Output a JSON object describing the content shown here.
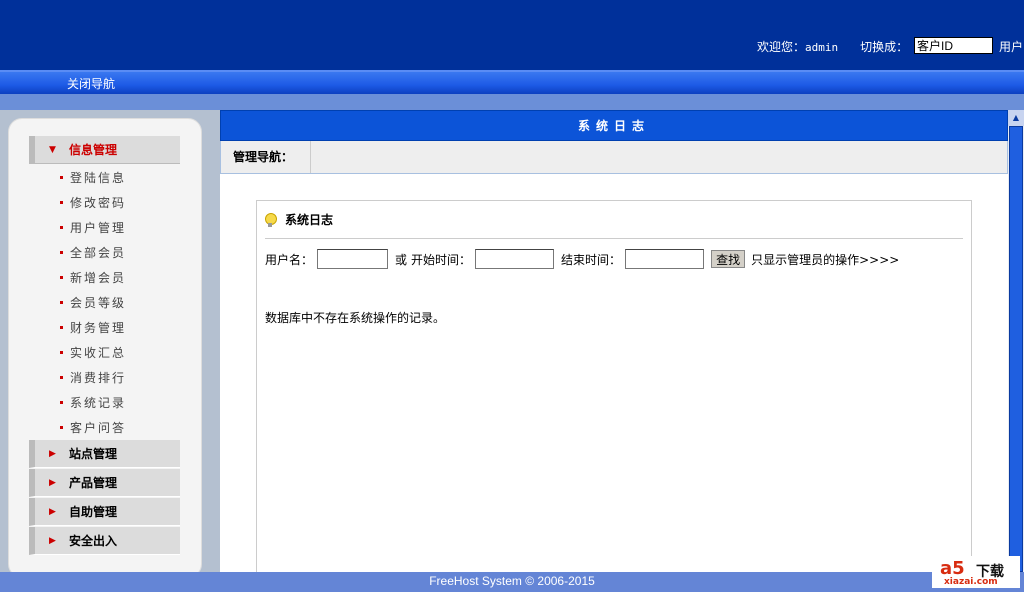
{
  "header": {
    "welcome": "欢迎您：",
    "username": "admin",
    "switch_label": "切换成：",
    "switch_value": "客户ID",
    "user_label": "用户"
  },
  "nav": {
    "close_nav": "关闭导航"
  },
  "sidebar": {
    "open_group": "信息管理",
    "items": [
      "登陆信息",
      "修改密码",
      "用户管理",
      "全部会员",
      "新增会员",
      "会员等级",
      "财务管理",
      "实收汇总",
      "消费排行",
      "系统记录",
      "客户问答"
    ],
    "groups": [
      "站点管理",
      "产品管理",
      "自助管理",
      "安全出入"
    ]
  },
  "main": {
    "title": "系统日志",
    "nav_label": "管理导航：",
    "box_title": "系统日志",
    "form": {
      "username_label": "用户名：",
      "or": "或",
      "start_label": "开始时间：",
      "end_label": "结束时间：",
      "find_button": "查找",
      "admin_only_link": "只显示管理员的操作>>>>"
    },
    "message": "数据库中不存在系统操作的记录。"
  },
  "footer": {
    "text": "FreeHost System © 2006-2015"
  },
  "watermark": {
    "logo": "a5",
    "text": "下载",
    "domain": "xiazai.com"
  }
}
